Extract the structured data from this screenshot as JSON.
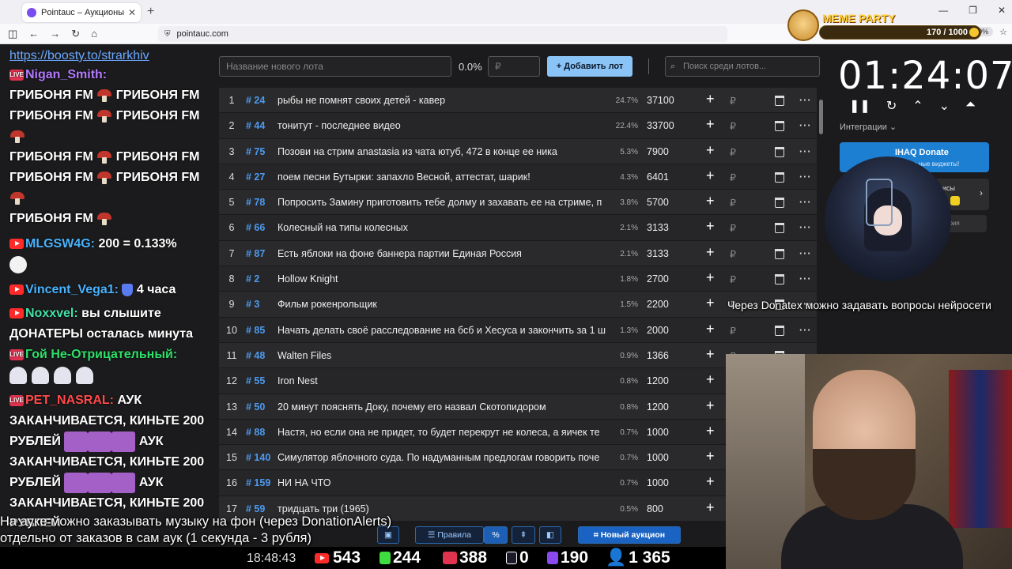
{
  "browser": {
    "tab_title": "Pointauc – Аукционы, лотереи",
    "url": "pointauc.com",
    "zoom": "90%"
  },
  "widget": {
    "title": "MEME PARTY",
    "progress": "170 / 1000",
    "progress_fraction": 0.17
  },
  "chat": {
    "link": "https://boosty.to/strarkhiv",
    "messages": [
      {
        "user": "Nigan_Smith:",
        "color": "purple",
        "text": ""
      },
      {
        "user": "",
        "color": "",
        "text": "ГРИБОНЯ FM"
      },
      {
        "user": "MLGSW4G:",
        "color": "blue",
        "text": "200 = 0.133%"
      },
      {
        "user": "Vincent_Vega1:",
        "color": "blue",
        "text": "4 часа"
      },
      {
        "user": "Noxxvel:",
        "color": "teal",
        "text": "вы слышите ДОНАТЕРЫ осталась минута"
      },
      {
        "user": "Гой Не-Отрицательный:",
        "color": "green",
        "text": ""
      },
      {
        "user": "PET_NASRAL:",
        "color": "red",
        "text": "АУК ЗАКАНЧИВАЕТСЯ, КИНЬТЕ 200 РУБЛЕЙ"
      },
      {
        "user": "",
        "color": "",
        "text": "АУК ЗАКАНЧИВАЕТСЯ, КИНЬТЕ 200 РУБЛЕЙ"
      },
      {
        "user": "",
        "color": "",
        "text": "АУК ЗАКАНЧИВАЕТСЯ, КИНЬТЕ 200 РУБЛЕЙ"
      }
    ]
  },
  "toolbar": {
    "lot_placeholder": "Название нового лота",
    "percent": "0.0%",
    "rub_placeholder": "₽",
    "add_label": "Добавить лот",
    "search_placeholder": "Поиск среди лотов..."
  },
  "lots": [
    {
      "n": "1",
      "id": "# 24",
      "name": "рыбы не помнят своих детей - кавер",
      "pct": "24.7%",
      "amount": "37100"
    },
    {
      "n": "2",
      "id": "# 44",
      "name": "тонитут - последнее видео",
      "pct": "22.4%",
      "amount": "33700"
    },
    {
      "n": "3",
      "id": "# 75",
      "name": "Позови на стрим anastasia из чата ютуб, 472 в конце ее ника",
      "pct": "5.3%",
      "amount": "7900"
    },
    {
      "n": "4",
      "id": "# 27",
      "name": "поем песни Бутырки: запахло Весной, аттестат, шарик!",
      "pct": "4.3%",
      "amount": "6401"
    },
    {
      "n": "5",
      "id": "# 78",
      "name": "Попросить Замину приготовить тебе долму и захавать ее на стриме, п",
      "pct": "3.8%",
      "amount": "5700"
    },
    {
      "n": "6",
      "id": "# 66",
      "name": "Колесный на типы колесных",
      "pct": "2.1%",
      "amount": "3133"
    },
    {
      "n": "7",
      "id": "# 87",
      "name": "Есть яблоки на фоне баннера партии Единая Россия",
      "pct": "2.1%",
      "amount": "3133"
    },
    {
      "n": "8",
      "id": "# 2",
      "name": "Hollow Knight",
      "pct": "1.8%",
      "amount": "2700"
    },
    {
      "n": "9",
      "id": "# 3",
      "name": "Фильм рокенрольщик",
      "pct": "1.5%",
      "amount": "2200"
    },
    {
      "n": "10",
      "id": "# 85",
      "name": "Начать делать своё расследование на бсб и Хесуса и закончить за 1 ш",
      "pct": "1.3%",
      "amount": "2000"
    },
    {
      "n": "11",
      "id": "# 48",
      "name": "Walten Files",
      "pct": "0.9%",
      "amount": "1366"
    },
    {
      "n": "12",
      "id": "# 55",
      "name": "Iron Nest",
      "pct": "0.8%",
      "amount": "1200"
    },
    {
      "n": "13",
      "id": "# 50",
      "name": "20 минут пояснять Доку, почему его назвал Скотопидором",
      "pct": "0.8%",
      "amount": "1200"
    },
    {
      "n": "14",
      "id": "# 88",
      "name": "Настя, но если она не придет, то будет перекрут не колеса, а яичек те",
      "pct": "0.7%",
      "amount": "1000"
    },
    {
      "n": "15",
      "id": "# 140",
      "name": "Симулятор яблочного суда. По надуманным предлогам говорить поче",
      "pct": "0.7%",
      "amount": "1000"
    },
    {
      "n": "16",
      "id": "# 159",
      "name": "НИ НА ЧТО",
      "pct": "0.7%",
      "amount": "1000"
    },
    {
      "n": "17",
      "id": "# 59",
      "name": "тридцать три (1965)",
      "pct": "0.5%",
      "amount": "800"
    }
  ],
  "timer": {
    "time": "01:24:07",
    "integrations_label": "Интеграции",
    "donate_title": "IHAQ Donate",
    "donate_sub": "уникальные виджеты!",
    "card2_label": "исы",
    "card3_label": "ория"
  },
  "overlay": {
    "donatex_text": "Через Donatex можно задавать вопросы нейросети",
    "notice_line1": "На ауке можно заказывать музыку на фон (через DonationAlerts)",
    "notice_line2": "отдельно от заказов в сам аук (1 секунда - 3 рубля)"
  },
  "bottombar": {
    "rules": "Правила",
    "new_auction": "Новый аукцион"
  },
  "stats": {
    "clock": "18:48:43",
    "youtube": "543",
    "kick": "244",
    "vk": "388",
    "rutube": "0",
    "twitch": "190",
    "viewers": "1 365"
  }
}
